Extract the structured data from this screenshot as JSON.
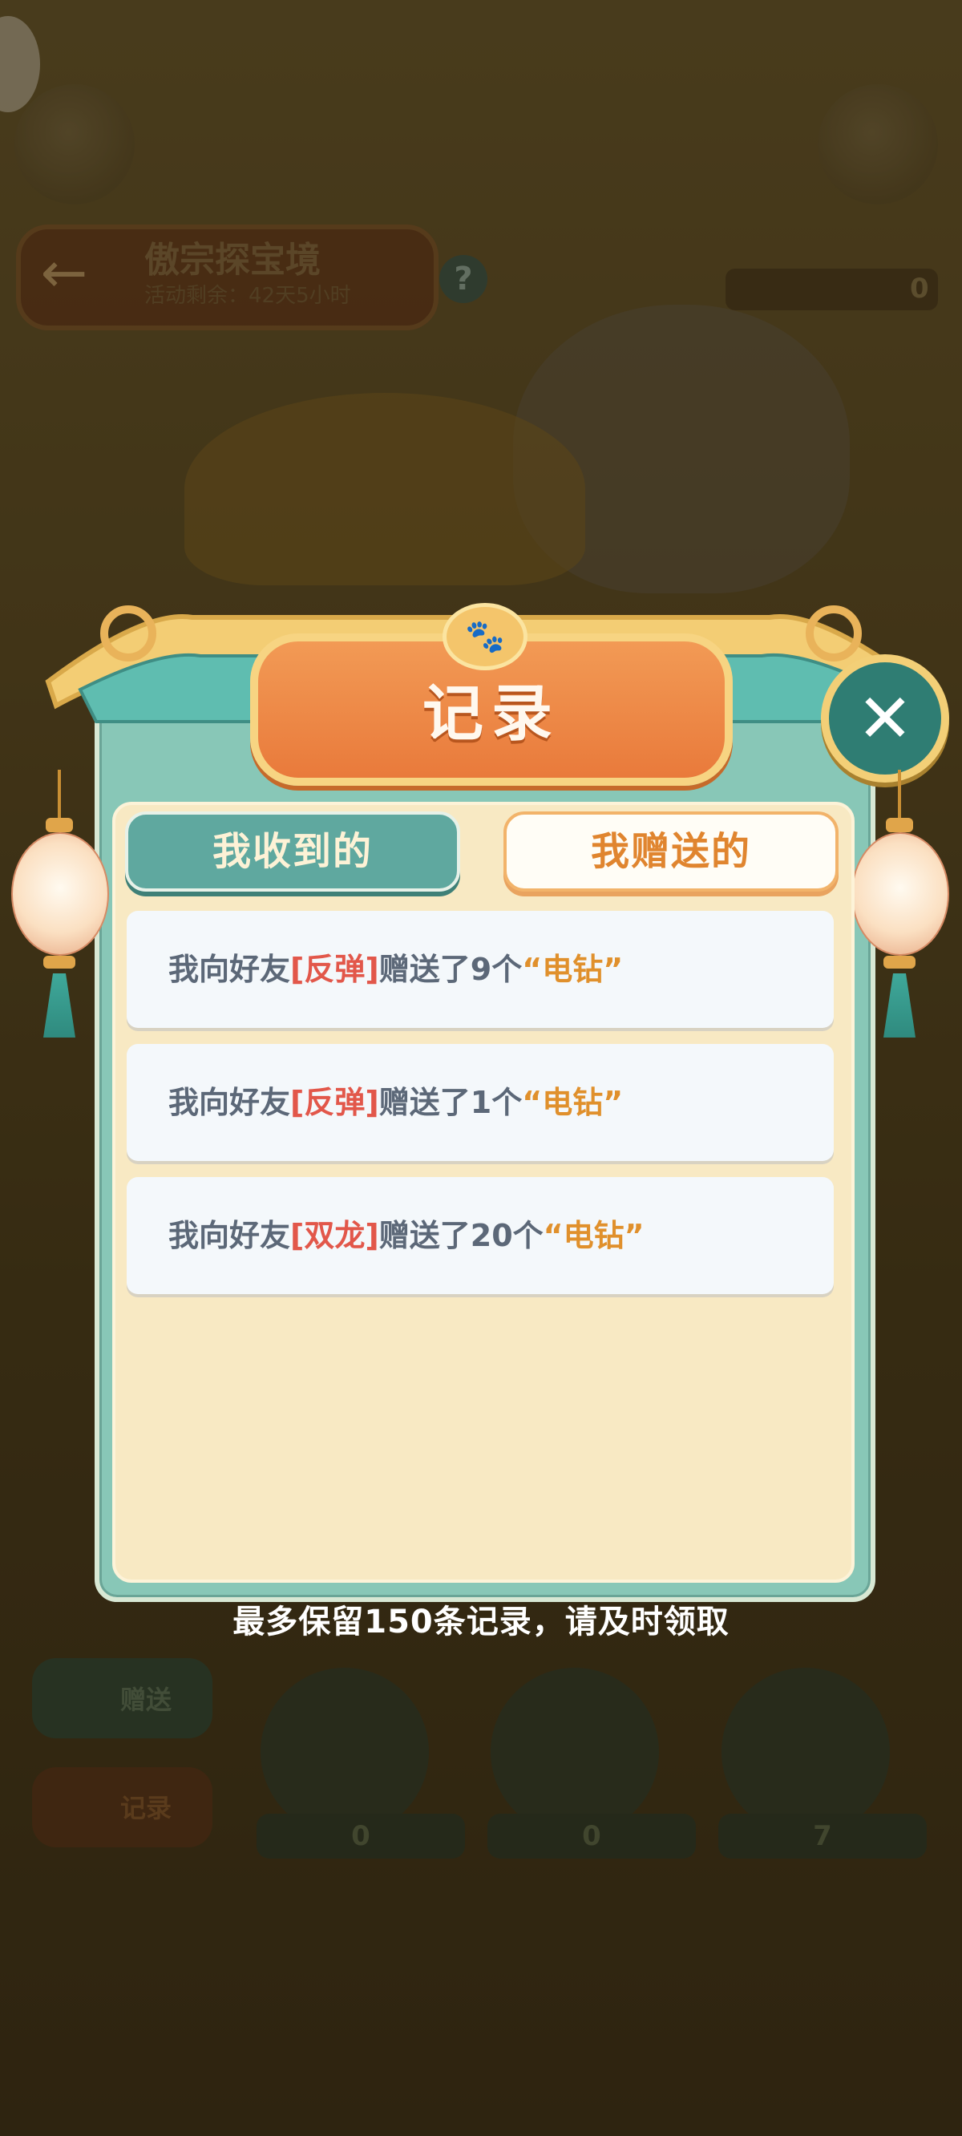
{
  "background": {
    "event_title": "傲宗探宝境",
    "event_subtitle": "活动剩余：42天5小时",
    "help_label": "?",
    "counter_value": "0",
    "side_buttons": {
      "gift": "赠送",
      "records": "记录"
    },
    "tool_counts": [
      "0",
      "0",
      "7"
    ]
  },
  "modal": {
    "title": "记录",
    "close_label": "✕",
    "tabs": [
      {
        "label": "我收到的",
        "active": false
      },
      {
        "label": "我赠送的",
        "active": true
      }
    ],
    "records": [
      {
        "prefix": "我向好友",
        "friend": "[反弹]",
        "action": "赠送了9个",
        "item": "“电钻”"
      },
      {
        "prefix": "我向好友",
        "friend": "[反弹]",
        "action": "赠送了1个",
        "item": "“电钻”"
      },
      {
        "prefix": "我向好友",
        "friend": "[双龙]",
        "action": "赠送了20个",
        "item": "“电钻”"
      }
    ],
    "footer_note": "最多保留150条记录，请及时领取"
  },
  "colors": {
    "teal": "#5fa89f",
    "orange": "#e97a3b",
    "friend_red": "#e2574a",
    "item_gold": "#e0902c",
    "panel_cream": "#f8e9c3"
  }
}
